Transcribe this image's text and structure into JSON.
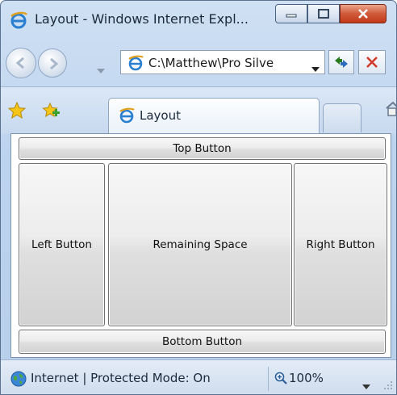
{
  "window": {
    "title": "Layout - Windows Internet Expl...",
    "caption_buttons": [
      "minimize-icon",
      "maximize-icon",
      "close-icon"
    ]
  },
  "navigation": {
    "address": "C:\\Matthew\\Pro Silve",
    "buttons": [
      "back-icon",
      "forward-icon",
      "refresh-icon",
      "stop-icon"
    ]
  },
  "tabs": [
    {
      "label": "Layout",
      "icon": "ie-page-icon",
      "active": true
    }
  ],
  "content": {
    "top_button": "Top Button",
    "left_button": "Left Button",
    "center_button": "Remaining Space",
    "right_button": "Right Button",
    "bottom_button": "Bottom Button"
  },
  "status": {
    "zone": "Internet | Protected Mode: On",
    "zoom": "100%",
    "zone_icon": "globe-icon"
  },
  "colors": {
    "chrome": "#bcd3ee",
    "close_button": "#c1391b",
    "stop_icon": "#d23b2a",
    "refresh_icon": "#2a7a1e"
  }
}
